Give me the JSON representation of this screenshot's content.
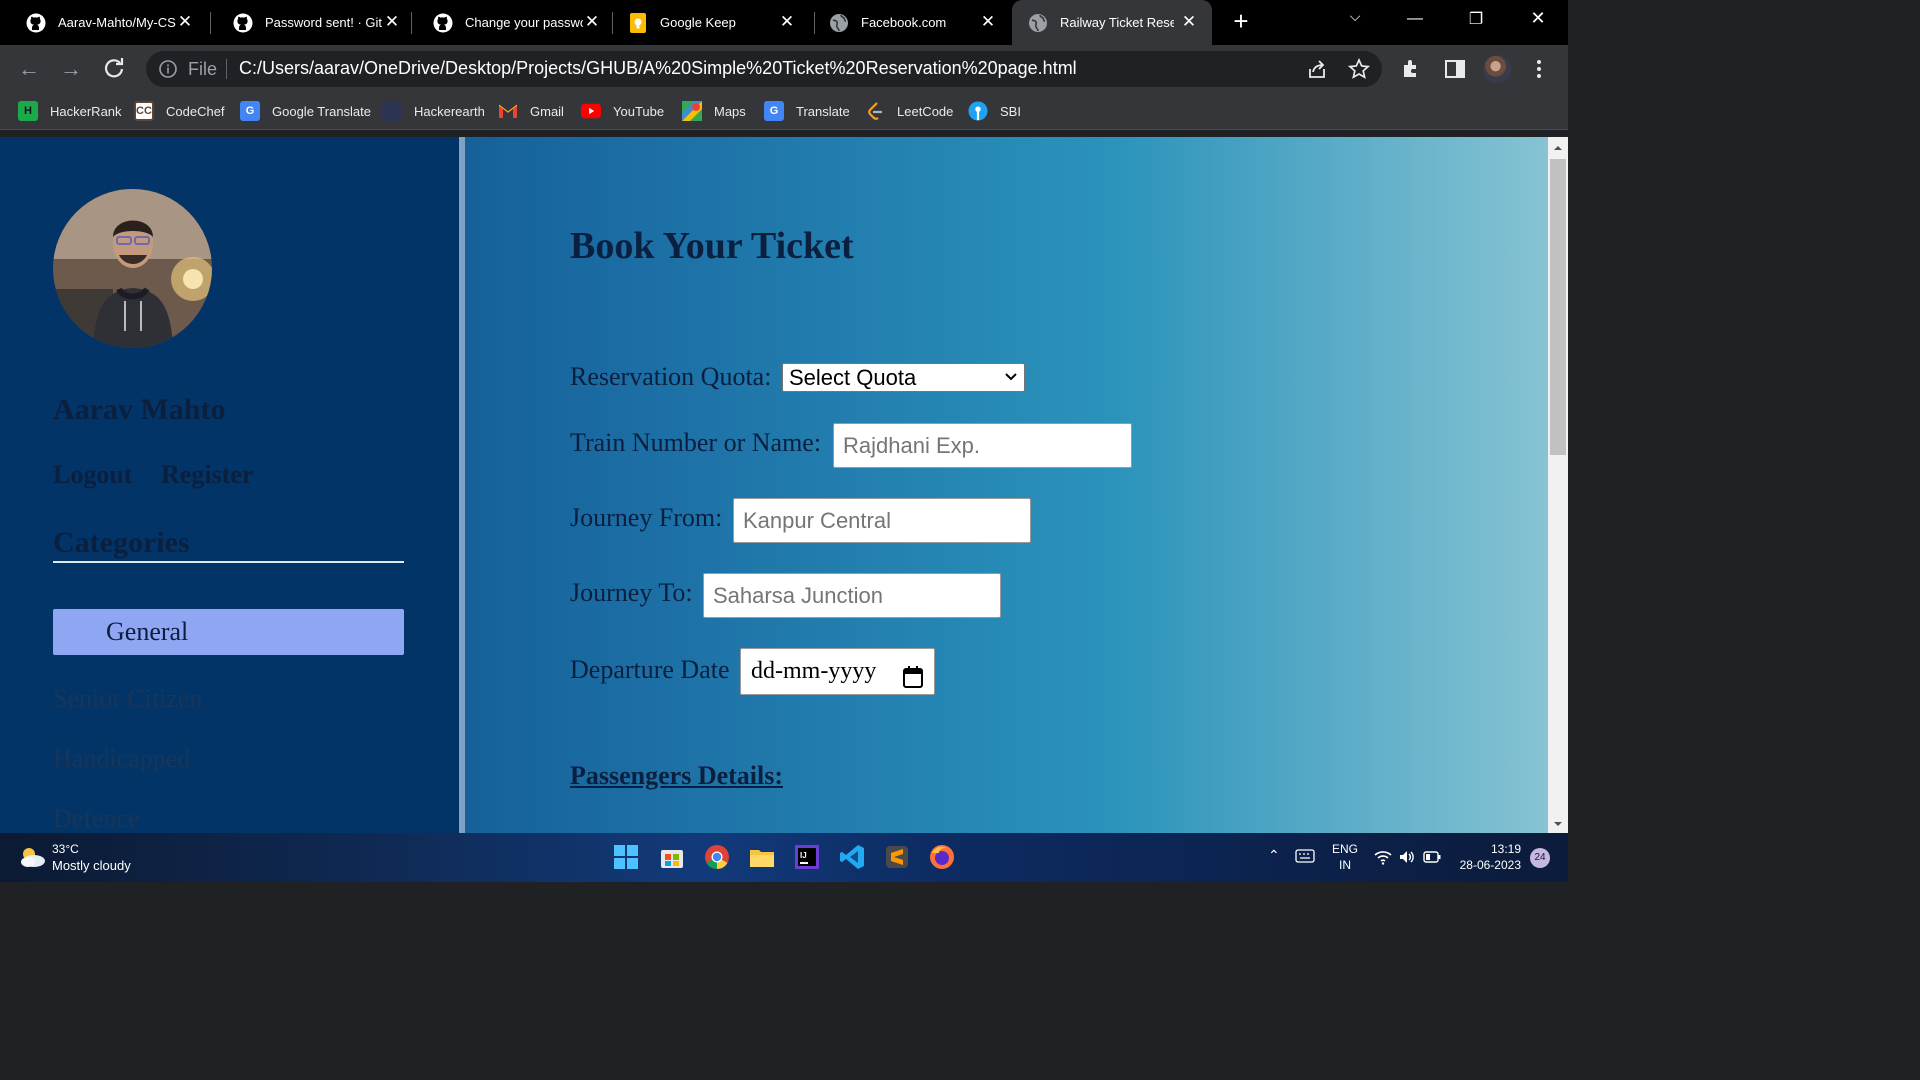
{
  "browser": {
    "tabs": [
      {
        "title": "Aarav-Mahto/My-CSS",
        "icon": "github-icon"
      },
      {
        "title": "Password sent! · GitHub",
        "icon": "github-icon"
      },
      {
        "title": "Change your password",
        "icon": "github-icon"
      },
      {
        "title": "Google Keep",
        "icon": "google-keep-icon"
      },
      {
        "title": "Facebook.com",
        "icon": "globe-icon"
      },
      {
        "title": "Railway Ticket Reservation",
        "icon": "globe-icon",
        "active": true
      }
    ],
    "omnibox": {
      "scheme_label": "File",
      "url": "C:/Users/aarav/OneDrive/Desktop/Projects/GHUB/A%20Simple%20Ticket%20Reservation%20page.html"
    },
    "bookmarks": [
      {
        "label": "HackerRank",
        "icon": "hackerrank-icon"
      },
      {
        "label": "CodeChef",
        "icon": "codechef-icon"
      },
      {
        "label": "Google Translate",
        "icon": "google-translate-icon"
      },
      {
        "label": "Hackerearth",
        "icon": "hackerearth-icon"
      },
      {
        "label": "Gmail",
        "icon": "gmail-icon"
      },
      {
        "label": "YouTube",
        "icon": "youtube-icon"
      },
      {
        "label": "Maps",
        "icon": "maps-icon"
      },
      {
        "label": "Translate",
        "icon": "google-translate-icon"
      },
      {
        "label": "LeetCode",
        "icon": "leetcode-icon"
      },
      {
        "label": "SBI",
        "icon": "sbi-icon"
      }
    ]
  },
  "sidebar": {
    "user_name": "Aarav Mahto",
    "logout_label": "Logout",
    "register_label": "Register",
    "categories_title": "Categories",
    "categories": [
      {
        "label": "General",
        "active": true
      },
      {
        "label": "Senior Citizen"
      },
      {
        "label": "Handicapped"
      },
      {
        "label": "Defence"
      }
    ]
  },
  "form": {
    "title": "Book Your Ticket",
    "quota_label": "Reservation Quota:",
    "quota_selected": "Select Quota",
    "train_label": "Train Number or Name:",
    "train_placeholder": "Rajdhani Exp.",
    "from_label": "Journey From:",
    "from_placeholder": "Kanpur Central",
    "to_label": "Journey To:",
    "to_placeholder": "Saharsa Junction",
    "date_label": "Departure Date",
    "date_placeholder": "dd-mm-yyyy",
    "passengers_title": "Passengers Details:"
  },
  "taskbar": {
    "weather_temp": "33°C",
    "weather_desc": "Mostly cloudy",
    "lang_top": "ENG",
    "lang_bottom": "IN",
    "time": "13:19",
    "date": "28-06-2023",
    "notifications": "24"
  },
  "colors": {
    "sidebar_bg": "#033467",
    "active_category": "#8fa6f3",
    "text_dark": "#0b1f3f"
  }
}
